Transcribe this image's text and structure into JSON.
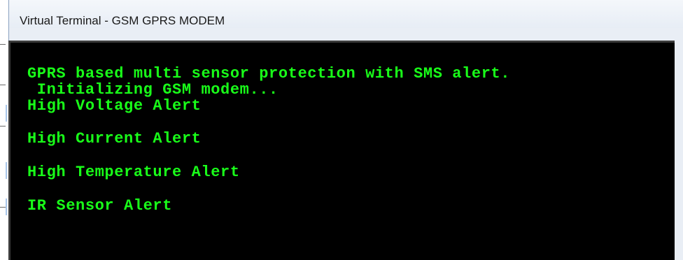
{
  "window": {
    "title": "Virtual Terminal - GSM GPRS MODEM"
  },
  "terminal": {
    "text_color": "#19ff19",
    "background_color": "#000000",
    "lines": [
      "GPRS based multi sensor protection with SMS alert.",
      " Initializing GSM modem...",
      "High Voltage Alert",
      "High Current Alert",
      "High Temperature Alert",
      "IR Sensor Alert"
    ]
  }
}
